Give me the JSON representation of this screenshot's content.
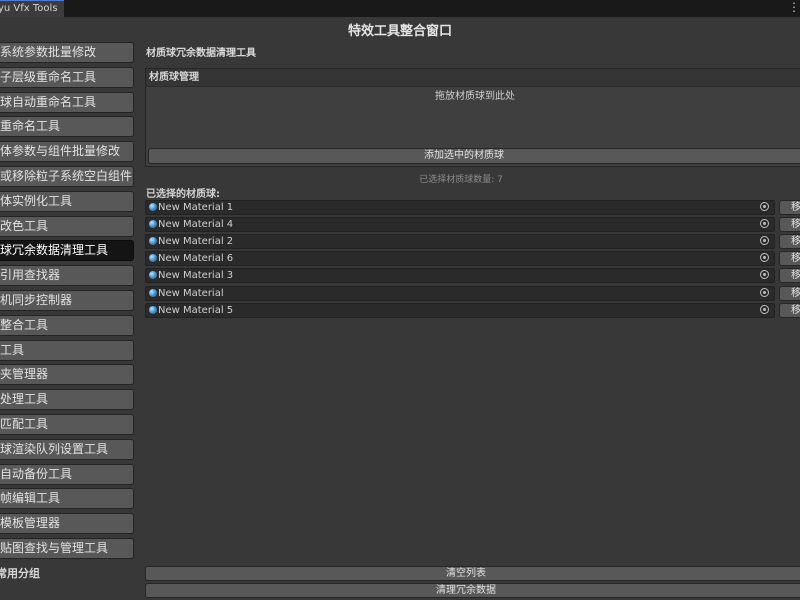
{
  "tab": {
    "title": "yu Vfx Tools",
    "menu_icon": "more-vertical-icon"
  },
  "window_title": "特效工具整合窗口",
  "sidebar": {
    "items": [
      {
        "label": "子系统参数批量修改",
        "active": false
      },
      {
        "label": "数子层级重命名工具",
        "active": false
      },
      {
        "label": "质球自动重命名工具",
        "active": false
      },
      {
        "label": "量重命名工具",
        "active": false
      },
      {
        "label": "刚体参数与组件批量修改",
        "active": false
      },
      {
        "label": "加或移除粒子系统空白组件",
        "active": false
      },
      {
        "label": "刚体实例化工具",
        "active": false
      },
      {
        "label": "改改色工具",
        "active": false
      },
      {
        "label": "质球冗余数据清理工具",
        "active": true
      },
      {
        "label": "源引用查找器",
        "active": false
      },
      {
        "label": "像机同步控制器",
        "active": false
      },
      {
        "label": "源整合工具",
        "active": false
      },
      {
        "label": "图工具",
        "active": false
      },
      {
        "label": "藏夹管理器",
        "active": false
      },
      {
        "label": "片处理工具",
        "active": false
      },
      {
        "label": "改匹配工具",
        "active": false
      },
      {
        "label": "质球渲染队列设置工具",
        "active": false
      },
      {
        "label": "景自动备份工具",
        "active": false
      },
      {
        "label": "画帧编辑工具",
        "active": false
      },
      {
        "label": "效模板管理器",
        "active": false
      },
      {
        "label": "度贴图查找与管理工具",
        "active": false
      }
    ],
    "group_label": "常用分组"
  },
  "main": {
    "section_title": "材质球冗余数据清理工具",
    "panel": {
      "header": "材质球管理",
      "drop_hint": "拖放材质球到此处",
      "add_button": "添加选中的材质球"
    },
    "count_text": "已选择材质球数量: 7",
    "selected_label": "已选择的材质球:",
    "materials": [
      {
        "name": "New Material 1",
        "remove_label": "移"
      },
      {
        "name": "New Material 4",
        "remove_label": "移"
      },
      {
        "name": "New Material 2",
        "remove_label": "移"
      },
      {
        "name": "New Material 6",
        "remove_label": "移"
      },
      {
        "name": "New Material 3",
        "remove_label": "移"
      },
      {
        "name": "New Material",
        "remove_label": "移"
      },
      {
        "name": "New Material 5",
        "remove_label": "移"
      }
    ],
    "clear_list_button": "清空列表",
    "clean_button": "清理冗余数据"
  }
}
